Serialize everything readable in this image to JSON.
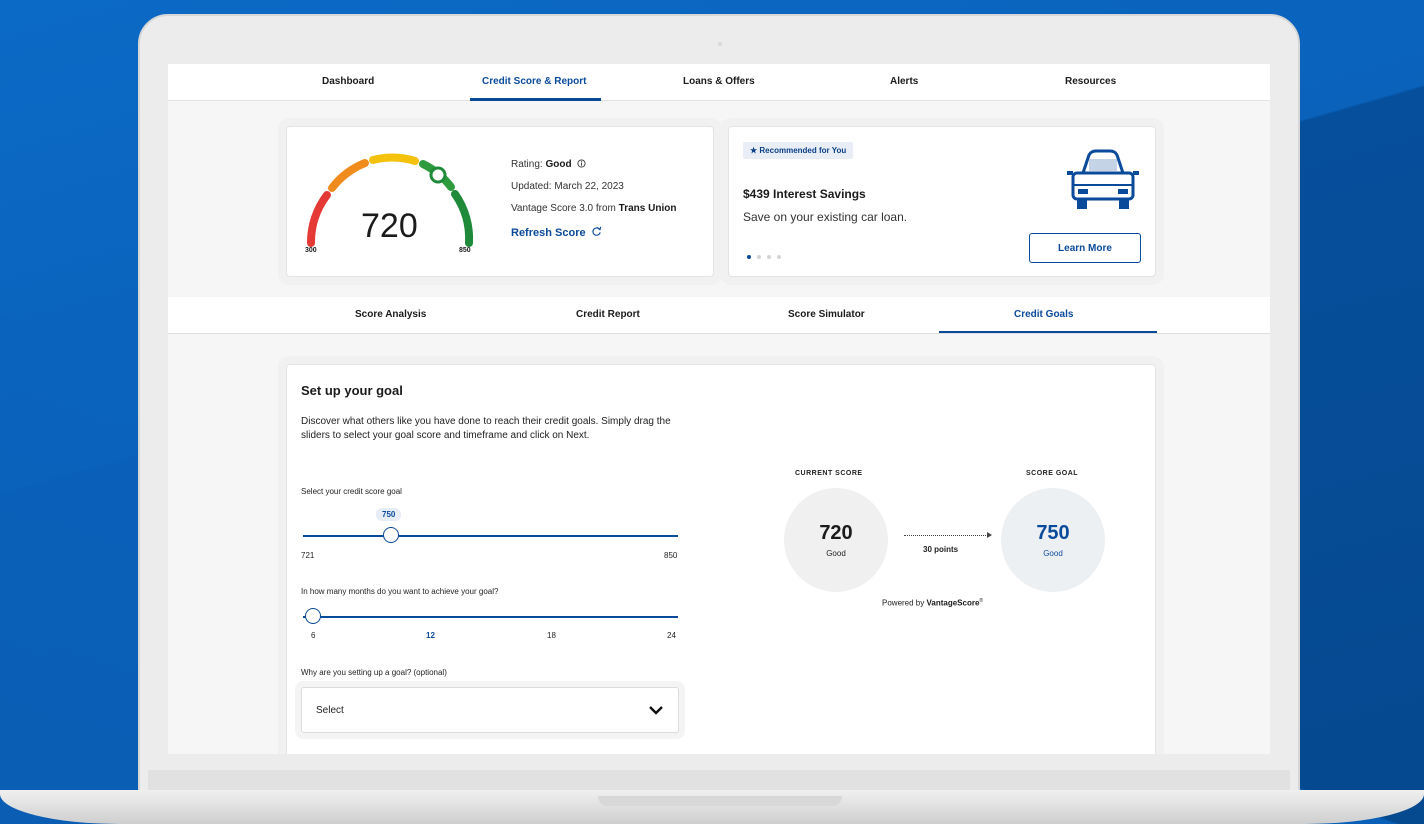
{
  "colors": {
    "accent": "#0a4a9a",
    "background": "#0a61b8"
  },
  "topnav": {
    "items": [
      {
        "label": "Dashboard"
      },
      {
        "label": "Credit Score & Report",
        "active": true
      },
      {
        "label": "Loans & Offers"
      },
      {
        "label": "Alerts"
      },
      {
        "label": "Resources"
      }
    ]
  },
  "score_card": {
    "score": "720",
    "min": "300",
    "max": "850",
    "rating_label": "Rating:",
    "rating_value": "Good",
    "updated": "Updated: March 22, 2023",
    "source_prefix": "Vantage Score 3.0 from",
    "source_bureau": "Trans Union",
    "refresh_label": "Refresh Score"
  },
  "promo_card": {
    "badge": "Recommended for You",
    "title": "$439 Interest Savings",
    "description": "Save on your existing car loan.",
    "button": "Learn More",
    "icon": "car-icon"
  },
  "subtabs": [
    {
      "label": "Score Analysis"
    },
    {
      "label": "Credit Report"
    },
    {
      "label": "Score Simulator"
    },
    {
      "label": "Credit Goals",
      "active": true
    }
  ],
  "goal": {
    "title": "Set up your goal",
    "description": "Discover what others like you have done to reach their credit goals. Simply drag the sliders to select your goal score and timeframe and click on Next.",
    "score_slider": {
      "label": "Select your credit score goal",
      "value": "750",
      "min": "721",
      "max": "850"
    },
    "months_slider": {
      "label": "In how many months do you want to achieve your goal?",
      "ticks": [
        "6",
        "12",
        "18",
        "24"
      ],
      "highlight": "12"
    },
    "reason": {
      "label": "Why are you setting up a goal? (optional)",
      "value": "Select"
    }
  },
  "comparison": {
    "current_label": "CURRENT SCORE",
    "current_score": "720",
    "current_rating": "Good",
    "goal_label": "SCORE GOAL",
    "goal_score": "750",
    "goal_rating": "Good",
    "points": "30 points",
    "powered_prefix": "Powered by",
    "powered_brand": "VantageScore",
    "powered_mark": "®"
  }
}
